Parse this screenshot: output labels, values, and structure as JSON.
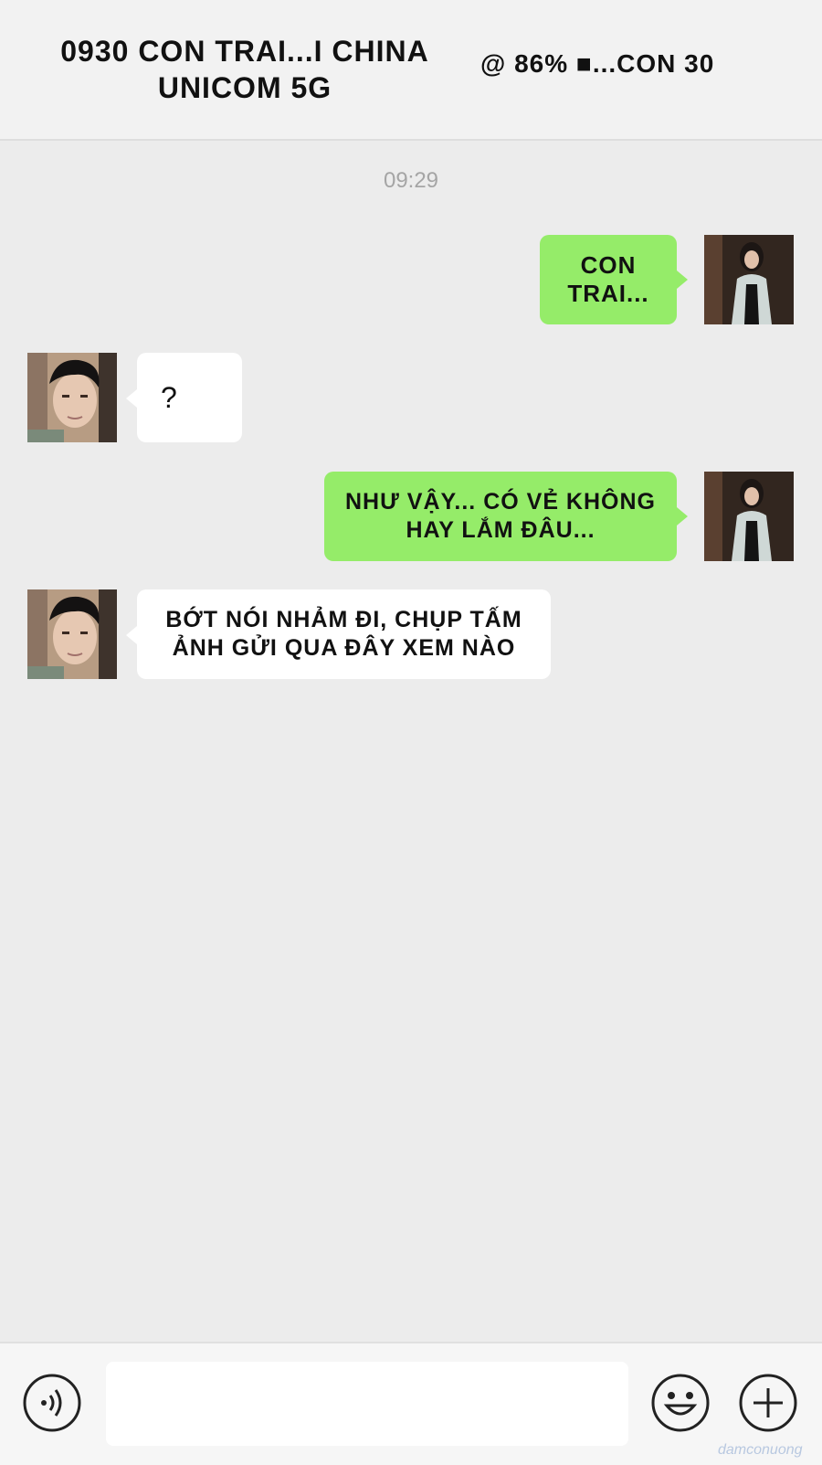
{
  "status_bar": {
    "left_text": "0930 CON TRAI...I CHINA UNICOM 5G",
    "right_text": "@ 86% ■...CON 30"
  },
  "chat": {
    "timestamp": "09:29",
    "messages": [
      {
        "sender": "self",
        "text": "CON TRAI..."
      },
      {
        "sender": "other",
        "text": "?"
      },
      {
        "sender": "self",
        "text": "NHƯ VẬY... CÓ VẺ KHÔNG HAY LẮM ĐÂU..."
      },
      {
        "sender": "other",
        "text": "BỚT NÓI NHẢM ĐI, CHỤP TẤM ẢNH GỬI QUA ĐÂY XEM NÀO"
      }
    ]
  },
  "input_bar": {
    "voice_icon": "voice-icon",
    "emoji_icon": "emoji-icon",
    "add_icon": "plus-icon",
    "text_value": ""
  },
  "watermark": "damconuong"
}
